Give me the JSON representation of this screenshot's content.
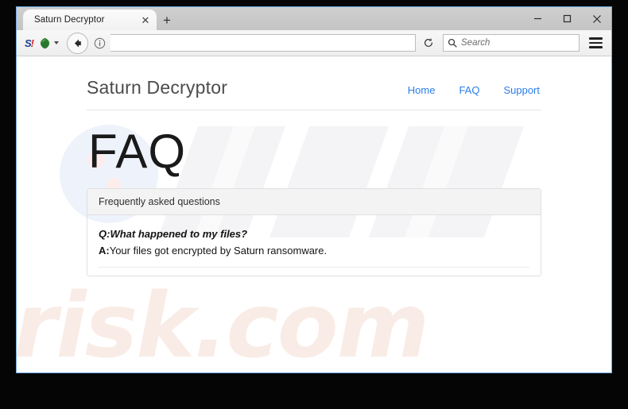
{
  "browser": {
    "tab": {
      "title": "Saturn Decryptor",
      "close_label": "✕"
    },
    "new_tab_label": "+",
    "window_controls": {
      "minimize": "minimize-button",
      "maximize": "maximize-button",
      "close": "close-button"
    },
    "toolbar": {
      "sophos_label": "S",
      "sophos_bang": "!",
      "shield_icon": "shield-dropdown-icon",
      "back_icon": "back-arrow-icon",
      "info_icon": "page-info-icon",
      "url_value": "",
      "url_placeholder": "",
      "reload_icon": "reload-icon",
      "search_placeholder": "Search",
      "search_value": "",
      "search_icon": "search-icon",
      "menu_icon": "hamburger-menu-icon"
    }
  },
  "watermark": {
    "text": "risk.com",
    "logo": "pcrisk-watermark-logo"
  },
  "site": {
    "brand": "Saturn Decryptor",
    "nav_links": [
      {
        "label": "Home"
      },
      {
        "label": "FAQ"
      },
      {
        "label": "Support"
      }
    ],
    "heading": "FAQ",
    "panel": {
      "heading": "Frequently asked questions",
      "entries": [
        {
          "q_label": "Q:",
          "question": "What happened to my files?",
          "a_label": "A:",
          "answer": "Your files got encrypted by Saturn ransomware."
        }
      ]
    }
  },
  "colors": {
    "link_blue": "#2b7de9",
    "panel_heading_bg": "#f3f3f3",
    "watermark_pink": "#f9ece6",
    "window_border_blue": "#72aee6"
  }
}
